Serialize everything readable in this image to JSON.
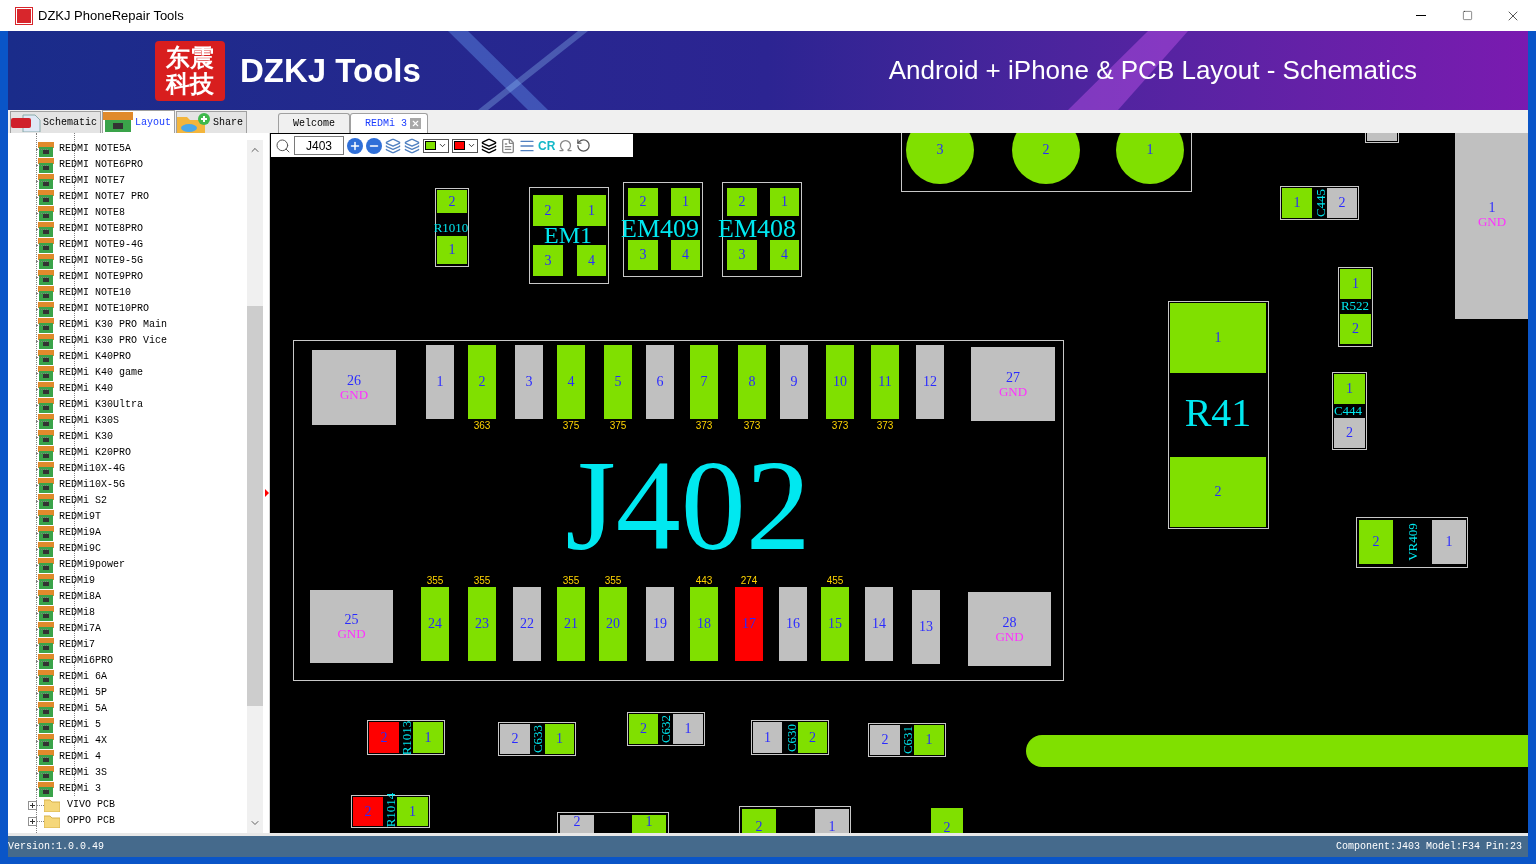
{
  "window": {
    "title": "DZKJ PhoneRepair Tools"
  },
  "banner": {
    "logo_chars": [
      "东震",
      "科技"
    ],
    "title": "DZKJ Tools",
    "tagline": "Android + iPhone & PCB Layout - Schematics"
  },
  "source_tabs": [
    {
      "kind": "pdf",
      "label": "Schematic",
      "selected": false
    },
    {
      "kind": "pads",
      "label": "Layout",
      "selected": true
    },
    {
      "kind": "share",
      "label": "Share",
      "selected": false
    }
  ],
  "doc_tabs": [
    {
      "label": "Welcome",
      "selected": false,
      "closable": false
    },
    {
      "label": "REDMi 3",
      "selected": true,
      "closable": true
    }
  ],
  "toolbar": {
    "search_value": "J403",
    "swatches": [
      {
        "color": "#80e000"
      },
      {
        "color": "#ff0000"
      }
    ],
    "cr_label": "CR"
  },
  "tree": {
    "items": [
      {
        "children": [
          {
            "label": "REDMI NOTE5A"
          },
          {
            "label": "REDMI NOTE6PRO"
          },
          {
            "label": "REDMI NOTE7"
          },
          {
            "label": "REDMI NOTE7 PRO"
          },
          {
            "label": "REDMI NOTE8"
          },
          {
            "label": "REDMI NOTE8PRO"
          },
          {
            "label": "REDMI NOTE9-4G"
          },
          {
            "label": "REDMI NOTE9-5G"
          },
          {
            "label": "REDMI NOTE9PRO"
          },
          {
            "label": "REDMI NOTE10"
          },
          {
            "label": "REDMI NOTE10PRO"
          },
          {
            "label": "REDMi K30 PRO Main"
          },
          {
            "label": "REDMi K30 PRO Vice"
          },
          {
            "label": "REDMi K40PRO"
          },
          {
            "label": "REDMi K40 game"
          },
          {
            "label": "REDMi K40"
          },
          {
            "label": "REDMi K30Ultra"
          },
          {
            "label": "REDMi K30S"
          },
          {
            "label": "REDMi K30"
          },
          {
            "label": "REDMi K20PRO"
          },
          {
            "label": "REDMi10X-4G"
          },
          {
            "label": "REDMi10X-5G"
          },
          {
            "label": "REDMi S2"
          },
          {
            "label": "REDMi9T"
          },
          {
            "label": "REDMi9A"
          },
          {
            "label": "REDMi9C"
          },
          {
            "label": "REDMi9power"
          },
          {
            "label": "REDMi9"
          },
          {
            "label": "REDMi8A"
          },
          {
            "label": "REDMi8"
          },
          {
            "label": "REDMi7A"
          },
          {
            "label": "REDMi7"
          },
          {
            "label": "REDMi6PRO"
          },
          {
            "label": "REDMi 6A"
          },
          {
            "label": "REDMi 5P"
          },
          {
            "label": "REDMi 5A"
          },
          {
            "label": "REDMi 5"
          },
          {
            "label": "REDMi 4X"
          },
          {
            "label": "REDMi 4"
          },
          {
            "label": "REDMi 3S"
          },
          {
            "label": "REDMi 3"
          }
        ]
      },
      {
        "label": "VIVO PCB",
        "expanded": false
      },
      {
        "label": "OPPO PCB",
        "expanded": false
      }
    ]
  },
  "canvas": {
    "components": [
      {
        "pads": [
          {
            "label": "3",
            "color": "#80e000"
          },
          {
            "label": "2",
            "color": "#80e000"
          },
          {
            "label": "1",
            "color": "#80e000"
          }
        ]
      },
      {
        "pads": [
          {
            "color": "#c0c0c0"
          }
        ]
      },
      {
        "ref": "R1010",
        "pads": [
          {
            "label": "2",
            "color": "#80e000"
          },
          {
            "label": "1",
            "color": "#80e000"
          }
        ]
      },
      {
        "ref": "EM1",
        "pads": [
          {
            "label": "2",
            "color": "#80e000"
          },
          {
            "label": "1",
            "color": "#80e000"
          },
          {
            "label": "3",
            "color": "#80e000"
          },
          {
            "label": "4",
            "color": "#80e000"
          }
        ]
      },
      {
        "ref": "EM409",
        "pads": [
          {
            "label": "2",
            "color": "#80e000"
          },
          {
            "label": "1",
            "color": "#80e000"
          },
          {
            "label": "3",
            "color": "#80e000"
          },
          {
            "label": "4",
            "color": "#80e000"
          }
        ]
      },
      {
        "ref": "EM408",
        "pads": [
          {
            "label": "2",
            "color": "#80e000"
          },
          {
            "label": "1",
            "color": "#80e000"
          },
          {
            "label": "3",
            "color": "#80e000"
          },
          {
            "label": "4",
            "color": "#80e000"
          }
        ]
      },
      {
        "ref": "J402",
        "pads": [
          {
            "label": "26",
            "net": "GND",
            "color": "#c0c0c0"
          },
          {
            "label": "1",
            "color": "#c0c0c0"
          },
          {
            "label": "2",
            "net": "363",
            "color": "#80e000"
          },
          {
            "label": "3",
            "color": "#c0c0c0"
          },
          {
            "label": "4",
            "net": "375",
            "color": "#80e000"
          },
          {
            "label": "5",
            "net": "375",
            "color": "#80e000"
          },
          {
            "label": "6",
            "color": "#c0c0c0"
          },
          {
            "label": "7",
            "net": "373",
            "color": "#80e000"
          },
          {
            "label": "8",
            "net": "373",
            "color": "#80e000"
          },
          {
            "label": "9",
            "color": "#c0c0c0"
          },
          {
            "label": "10",
            "net": "373",
            "color": "#80e000"
          },
          {
            "label": "11",
            "net": "373",
            "color": "#80e000"
          },
          {
            "label": "12",
            "color": "#c0c0c0"
          },
          {
            "label": "27",
            "net": "GND",
            "color": "#c0c0c0"
          },
          {
            "label": "25",
            "net": "GND",
            "color": "#c0c0c0"
          },
          {
            "label": "24",
            "net": "355",
            "color": "#80e000"
          },
          {
            "label": "23",
            "net": "355",
            "color": "#80e000"
          },
          {
            "label": "22",
            "color": "#c0c0c0"
          },
          {
            "label": "21",
            "net": "355",
            "color": "#80e000"
          },
          {
            "label": "20",
            "net": "355",
            "color": "#80e000"
          },
          {
            "label": "19",
            "color": "#c0c0c0"
          },
          {
            "label": "18",
            "net": "443",
            "color": "#80e000"
          },
          {
            "label": "17",
            "net": "274",
            "color": "#ff0000"
          },
          {
            "label": "16",
            "color": "#c0c0c0"
          },
          {
            "label": "15",
            "net": "455",
            "color": "#80e000"
          },
          {
            "label": "14",
            "color": "#c0c0c0"
          },
          {
            "label": "13",
            "color": "#c0c0c0"
          },
          {
            "label": "28",
            "net": "GND",
            "color": "#c0c0c0"
          }
        ]
      },
      {
        "ref": "R41",
        "pads": [
          {
            "label": "1",
            "color": "#80e000"
          },
          {
            "label": "2",
            "color": "#80e000"
          }
        ]
      },
      {
        "ref": "C445",
        "pads": [
          {
            "label": "1",
            "color": "#80e000"
          },
          {
            "label": "2",
            "color": "#c0c0c0"
          }
        ]
      },
      {
        "pads": [
          {
            "label": "1",
            "net": "GND",
            "color": "#c0c0c0"
          }
        ]
      },
      {
        "ref": "R522",
        "pads": [
          {
            "label": "1",
            "color": "#80e000"
          },
          {
            "label": "2",
            "color": "#80e000"
          }
        ]
      },
      {
        "ref": "C444",
        "pads": [
          {
            "label": "1",
            "color": "#80e000"
          },
          {
            "label": "2",
            "color": "#c0c0c0"
          }
        ]
      },
      {
        "ref": "VR409",
        "pads": [
          {
            "label": "2",
            "color": "#80e000"
          },
          {
            "label": "1",
            "color": "#c0c0c0"
          }
        ]
      },
      {
        "ref": "R1013",
        "pads": [
          {
            "label": "2",
            "color": "#ff0000"
          },
          {
            "label": "1",
            "color": "#80e000"
          }
        ]
      },
      {
        "ref": "C633",
        "pads": [
          {
            "label": "2",
            "color": "#c0c0c0"
          },
          {
            "label": "1",
            "color": "#80e000"
          }
        ]
      },
      {
        "ref": "C632",
        "pads": [
          {
            "label": "2",
            "color": "#80e000"
          },
          {
            "label": "1",
            "color": "#c0c0c0"
          }
        ]
      },
      {
        "ref": "C630",
        "pads": [
          {
            "label": "1",
            "color": "#c0c0c0"
          },
          {
            "label": "2",
            "color": "#80e000"
          }
        ]
      },
      {
        "ref": "C631",
        "pads": [
          {
            "label": "2",
            "color": "#c0c0c0"
          },
          {
            "label": "1",
            "color": "#80e000"
          }
        ]
      },
      {
        "ref": "R1014",
        "pads": [
          {
            "label": "2",
            "color": "#ff0000"
          },
          {
            "label": "1",
            "color": "#80e000"
          }
        ]
      },
      {
        "pads": [
          {
            "label": "2",
            "color": "#c0c0c0"
          },
          {
            "label": "1",
            "color": "#80e000"
          }
        ]
      },
      {
        "pads": [
          {
            "label": "2",
            "color": "#80e000"
          },
          {
            "label": "1",
            "color": "#c0c0c0"
          }
        ]
      },
      {
        "pads": [
          {
            "label": "2",
            "color": "#80e000"
          }
        ]
      }
    ]
  },
  "status_bar": {
    "version": "Version:1.0.0.49",
    "component_info": "Component:J403 Model:F34 Pin:23"
  }
}
